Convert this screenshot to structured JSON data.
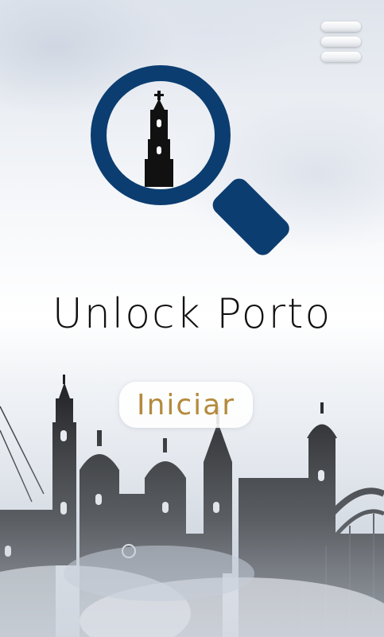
{
  "app": {
    "title": "Unlock Porto"
  },
  "actions": {
    "start_label": "Iniciar"
  },
  "icons": {
    "menu": "hamburger-menu-icon",
    "logo": "magnifying-glass-tower-icon",
    "background": "porto-skyline-silhouette"
  },
  "colors": {
    "brand_blue": "#0b3d70",
    "button_text_gold": "#b48a3c",
    "title_text": "#111111"
  }
}
